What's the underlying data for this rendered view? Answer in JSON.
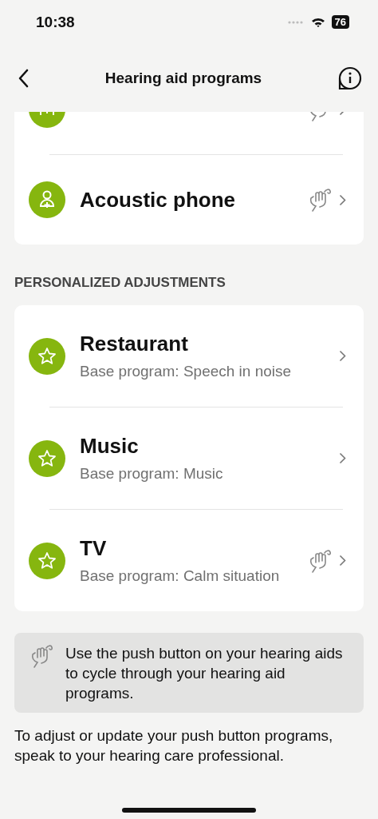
{
  "status_bar": {
    "time": "10:38",
    "battery": "76"
  },
  "nav": {
    "title": "Hearing aid programs"
  },
  "programs": [
    {
      "kind": "echo",
      "push_button": true
    },
    {
      "kind": "person",
      "title": "Acoustic phone",
      "push_button": true
    }
  ],
  "personalized": {
    "heading": "PERSONALIZED ADJUSTMENTS",
    "items": [
      {
        "kind": "star",
        "title": "Restaurant",
        "subtitle": "Base program: Speech in noise",
        "push_button": false
      },
      {
        "kind": "star",
        "title": "Music",
        "subtitle": "Base program: Music",
        "push_button": false
      },
      {
        "kind": "star",
        "title": "TV",
        "subtitle": "Base program: Calm situation",
        "push_button": true
      }
    ]
  },
  "info_box": {
    "text": "Use the push button on your hearing aids to cycle through your hearing aid programs."
  },
  "footer_note": "To adjust or update your push button programs, speak to your hearing care professional."
}
